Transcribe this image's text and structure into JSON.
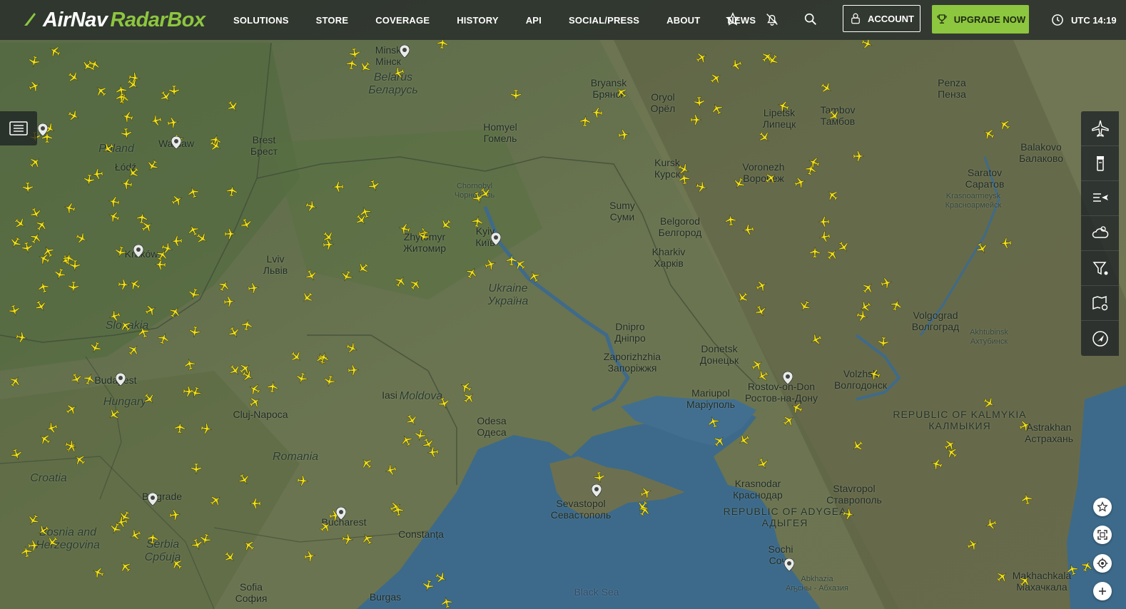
{
  "brand": {
    "name_part1": "AirNav",
    "name_part2": "RadarBox",
    "accent": "#8dc63f"
  },
  "nav": [
    {
      "label": "SOLUTIONS"
    },
    {
      "label": "STORE"
    },
    {
      "label": "COVERAGE"
    },
    {
      "label": "HISTORY"
    },
    {
      "label": "API"
    },
    {
      "label": "SOCIAL/PRESS"
    },
    {
      "label": "ABOUT"
    },
    {
      "label": "NEWS"
    }
  ],
  "header_icons": [
    "star-icon",
    "notifications-off-icon",
    "search-icon"
  ],
  "account": {
    "label": "ACCOUNT",
    "icon": "user-icon"
  },
  "upgrade": {
    "label": "UPGRADE NOW",
    "icon": "trophy-icon"
  },
  "clock": {
    "label": "UTC 14:19",
    "icon": "clock-icon"
  },
  "left_panel": {
    "icon": "list-panel-icon"
  },
  "right_toolbar": [
    {
      "icon": "flights-layer-icon"
    },
    {
      "icon": "airport-tower-icon"
    },
    {
      "icon": "flight-list-icon"
    },
    {
      "icon": "weather-icon"
    },
    {
      "icon": "filter-icon"
    },
    {
      "icon": "map-settings-icon"
    },
    {
      "icon": "navigation-icon"
    }
  ],
  "map_controls": [
    {
      "icon": "favorite-star-icon"
    },
    {
      "icon": "fullscreen-icon"
    },
    {
      "icon": "locate-icon"
    },
    {
      "icon": "zoom-in-icon"
    }
  ],
  "map_labels": [
    {
      "l1": "Belarus",
      "l2": "Беларусь",
      "type": "country"
    },
    {
      "l1": "Ukraine",
      "l2": "Україна",
      "type": "country"
    },
    {
      "l1": "Poland",
      "l2": "",
      "type": "country"
    },
    {
      "l1": "Slovakia",
      "l2": "",
      "type": "country"
    },
    {
      "l1": "Hungary",
      "l2": "",
      "type": "country"
    },
    {
      "l1": "Romania",
      "l2": "",
      "type": "country"
    },
    {
      "l1": "Moldova",
      "l2": "",
      "type": "country"
    },
    {
      "l1": "Bosnia and",
      "l2": "Herzegovina",
      "type": "country"
    },
    {
      "l1": "Serbia",
      "l2": "Србија",
      "type": "country"
    },
    {
      "l1": "Minsk",
      "l2": "Мінск",
      "type": "city"
    },
    {
      "l1": "Bryansk",
      "l2": "Брянск",
      "type": "city"
    },
    {
      "l1": "Oryol",
      "l2": "Орёл",
      "type": "city"
    },
    {
      "l1": "Homyel",
      "l2": "Гомель",
      "type": "city"
    },
    {
      "l1": "Brest",
      "l2": "Брест",
      "type": "city"
    },
    {
      "l1": "Warsaw",
      "l2": "",
      "type": "city"
    },
    {
      "l1": "Łódź",
      "l2": "",
      "type": "city"
    },
    {
      "l1": "Kraków",
      "l2": "",
      "type": "city"
    },
    {
      "l1": "Lviv",
      "l2": "Львів",
      "type": "city"
    },
    {
      "l1": "Chornobyl",
      "l2": "Чорнобиль",
      "type": "small"
    },
    {
      "l1": "Zhytomyr",
      "l2": "Житомир",
      "type": "city"
    },
    {
      "l1": "Kyiv",
      "l2": "Київ",
      "type": "city"
    },
    {
      "l1": "Kursk",
      "l2": "Курск",
      "type": "city"
    },
    {
      "l1": "Sumy",
      "l2": "Суми",
      "type": "city"
    },
    {
      "l1": "Belgorod",
      "l2": "Белгород",
      "type": "city"
    },
    {
      "l1": "Kharkiv",
      "l2": "Харків",
      "type": "city"
    },
    {
      "l1": "Voronezh",
      "l2": "Воронеж",
      "type": "city"
    },
    {
      "l1": "Lipetsk",
      "l2": "Липецк",
      "type": "city"
    },
    {
      "l1": "Tambov",
      "l2": "Тамбов",
      "type": "city"
    },
    {
      "l1": "Penza",
      "l2": "Пенза",
      "type": "city"
    },
    {
      "l1": "Saratov",
      "l2": "Саратов",
      "type": "city"
    },
    {
      "l1": "Balakovo",
      "l2": "Балаково",
      "type": "city"
    },
    {
      "l1": "Krasnoarmeysk",
      "l2": "Красноармейск",
      "type": "small"
    },
    {
      "l1": "Dnipro",
      "l2": "Дніпро",
      "type": "city"
    },
    {
      "l1": "Zaporizhzhia",
      "l2": "Запоріжжя",
      "type": "city"
    },
    {
      "l1": "Donetsk",
      "l2": "Донецьк",
      "type": "city"
    },
    {
      "l1": "Mariupol",
      "l2": "Маріуполь",
      "type": "city"
    },
    {
      "l1": "Rostov-on-Don",
      "l2": "Ростов-на-Дону",
      "type": "city"
    },
    {
      "l1": "Volgograd",
      "l2": "Волгоград",
      "type": "city"
    },
    {
      "l1": "Volzhsk",
      "l2": "Волгодонск",
      "type": "city"
    },
    {
      "l1": "Akhtubinsk",
      "l2": "Ахтубинск",
      "type": "small"
    },
    {
      "l1": "REPUBLIC OF KALMYKIA",
      "l2": "КАЛМЫКИЯ",
      "type": "region"
    },
    {
      "l1": "Astrakhan",
      "l2": "Астрахань",
      "type": "city"
    },
    {
      "l1": "Odesa",
      "l2": "Одеса",
      "type": "city"
    },
    {
      "l1": "Iasi",
      "l2": "",
      "type": "city"
    },
    {
      "l1": "Cluj-Napoca",
      "l2": "",
      "type": "city"
    },
    {
      "l1": "Budapest",
      "l2": "",
      "type": "city"
    },
    {
      "l1": "Belgrade",
      "l2": "",
      "type": "city"
    },
    {
      "l1": "Bucharest",
      "l2": "",
      "type": "city"
    },
    {
      "l1": "Constanța",
      "l2": "",
      "type": "city"
    },
    {
      "l1": "Sofia",
      "l2": "София",
      "type": "city"
    },
    {
      "l1": "Burgas",
      "l2": "",
      "type": "city"
    },
    {
      "l1": "Sevastopol",
      "l2": "Севастополь",
      "type": "city"
    },
    {
      "l1": "Krasnodar",
      "l2": "Краснодар",
      "type": "city"
    },
    {
      "l1": "REPUBLIC OF ADYGEA",
      "l2": "АДЫГЕЯ",
      "type": "region"
    },
    {
      "l1": "Stavropol",
      "l2": "Ставрополь",
      "type": "city"
    },
    {
      "l1": "Sochi",
      "l2": "Сочи",
      "type": "city"
    },
    {
      "l1": "Abkhazia",
      "l2": "Аҧсны - Абхазия",
      "type": "small"
    },
    {
      "l1": "Makhachkala",
      "l2": "Махачкала",
      "type": "city"
    },
    {
      "l1": "Black Sea",
      "l2": "",
      "type": "sea"
    },
    {
      "l1": "Croatia",
      "l2": "",
      "type": "country"
    }
  ]
}
